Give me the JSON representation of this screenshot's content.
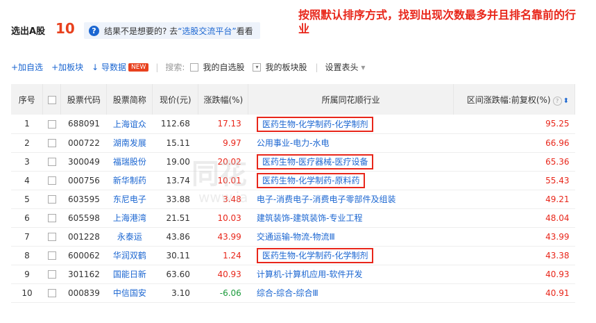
{
  "header": {
    "title": "选出A股",
    "count": "10",
    "tip_prefix": "结果不是想要的? 去",
    "tip_link": "“选股交流平台”",
    "tip_suffix": "看看",
    "qmark": "?"
  },
  "annotation": {
    "text": "按照默认排序方式，找到出现次数最多并且排名靠前的行业",
    "color": "#e8261a"
  },
  "toolbar": {
    "add_self": "+加自选",
    "add_board": "+加板块",
    "export": "导数据",
    "new_badge": "NEW",
    "search_label": "搜索:",
    "my_self": "我的自选股",
    "my_board": "我的板块股",
    "settings": "设置表头",
    "settings_arrow": "▾",
    "sep": "|",
    "download_icon": "↓"
  },
  "table": {
    "headers": {
      "index": "序号",
      "code": "股票代码",
      "name": "股票简称",
      "price": "现价(元)",
      "change": "涨跌幅(%)",
      "industry": "所属同花顺行业",
      "range": "区间涨跌幅:前复权(%)",
      "range_help": "?",
      "range_sort": "⬍"
    },
    "rows": [
      {
        "index": "1",
        "code": "688091",
        "name": "上海谊众",
        "price": "112.68",
        "change": "17.13",
        "industry": "医药生物-化学制药-化学制剂",
        "range": "95.25",
        "boxed": true
      },
      {
        "index": "2",
        "code": "000722",
        "name": "湖南发展",
        "price": "15.11",
        "change": "9.97",
        "industry": "公用事业-电力-水电",
        "range": "66.96",
        "boxed": false
      },
      {
        "index": "3",
        "code": "300049",
        "name": "福瑞股份",
        "price": "19.00",
        "change": "20.02",
        "industry": "医药生物-医疗器械-医疗设备",
        "range": "65.36",
        "boxed": true
      },
      {
        "index": "4",
        "code": "000756",
        "name": "新华制药",
        "price": "13.74",
        "change": "10.01",
        "industry": "医药生物-化学制药-原料药",
        "range": "55.43",
        "boxed": true
      },
      {
        "index": "5",
        "code": "603595",
        "name": "东尼电子",
        "price": "33.88",
        "change": "3.48",
        "industry": "电子-消费电子-消费电子零部件及组装",
        "range": "49.21",
        "boxed": false
      },
      {
        "index": "6",
        "code": "605598",
        "name": "上海港湾",
        "price": "21.51",
        "change": "10.03",
        "industry": "建筑装饰-建筑装饰-专业工程",
        "range": "48.04",
        "boxed": false
      },
      {
        "index": "7",
        "code": "001228",
        "name": "永泰运",
        "price": "43.86",
        "change": "43.99",
        "industry": "交通运输-物流-物流Ⅲ",
        "range": "43.99",
        "boxed": false
      },
      {
        "index": "8",
        "code": "600062",
        "name": "华润双鹤",
        "price": "30.11",
        "change": "1.24",
        "industry": "医药生物-化学制药-化学制剂",
        "range": "43.38",
        "boxed": true
      },
      {
        "index": "9",
        "code": "301162",
        "name": "国能日新",
        "price": "63.60",
        "change": "40.93",
        "industry": "计算机-计算机应用-软件开发",
        "range": "40.93",
        "boxed": false
      },
      {
        "index": "10",
        "code": "000839",
        "name": "中信国安",
        "price": "3.10",
        "change": "-6.06",
        "industry": "综合-综合-综合Ⅲ",
        "range": "40.91",
        "boxed": false
      }
    ]
  },
  "watermark": {
    "line1": "同花",
    "line2": "www.ia"
  }
}
